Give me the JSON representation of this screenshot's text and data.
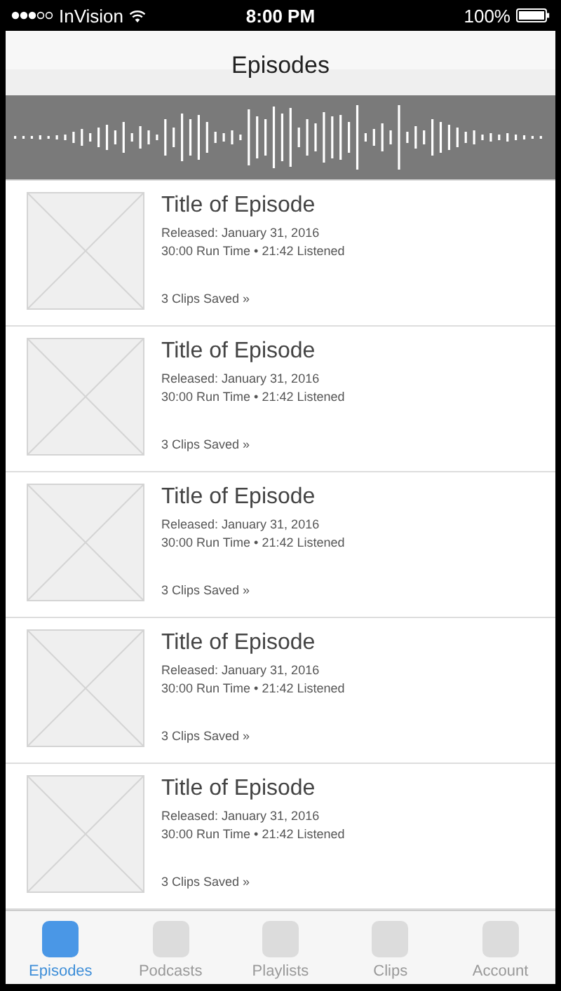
{
  "status_bar": {
    "carrier": "InVision",
    "time": "8:00 PM",
    "battery": "100%"
  },
  "nav": {
    "title": "Episodes"
  },
  "episodes": [
    {
      "title": "Title of Episode",
      "released": "Released: January 31, 2016",
      "runtime": "30:00 Run Time • 21:42 Listened",
      "clips": "3 Clips Saved »"
    },
    {
      "title": "Title of Episode",
      "released": "Released: January 31, 2016",
      "runtime": "30:00 Run Time • 21:42 Listened",
      "clips": "3 Clips Saved »"
    },
    {
      "title": "Title of Episode",
      "released": "Released: January 31, 2016",
      "runtime": "30:00 Run Time • 21:42 Listened",
      "clips": "3 Clips Saved »"
    },
    {
      "title": "Title of Episode",
      "released": "Released: January 31, 2016",
      "runtime": "30:00 Run Time • 21:42 Listened",
      "clips": "3 Clips Saved »"
    },
    {
      "title": "Title of Episode",
      "released": "Released: January 31, 2016",
      "runtime": "30:00 Run Time • 21:42 Listened",
      "clips": "3 Clips Saved »"
    }
  ],
  "tabs": [
    {
      "label": "Episodes",
      "selected": true
    },
    {
      "label": "Podcasts",
      "selected": false
    },
    {
      "label": "Playlists",
      "selected": false
    },
    {
      "label": "Clips",
      "selected": false
    },
    {
      "label": "Account",
      "selected": false
    }
  ]
}
